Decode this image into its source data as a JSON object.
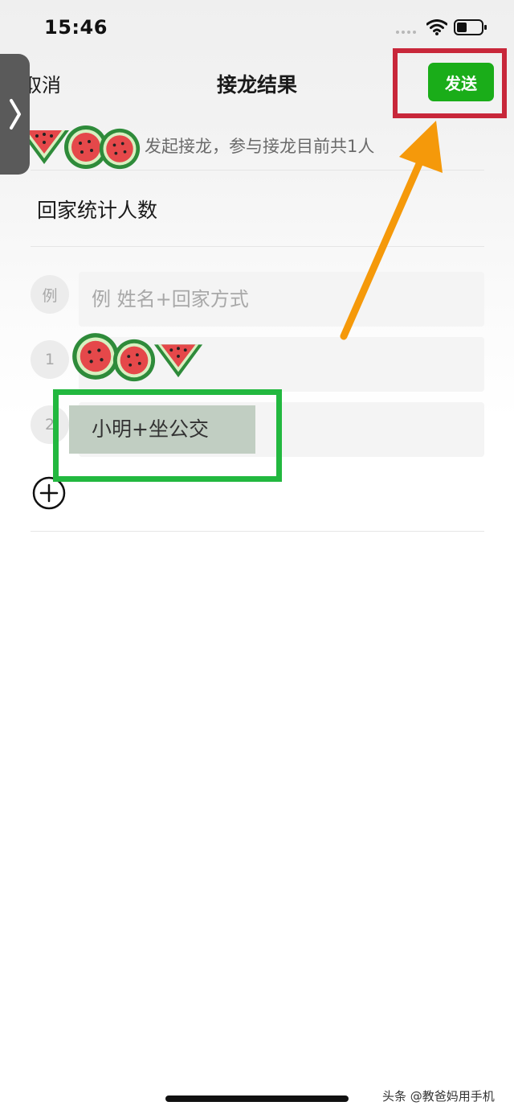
{
  "status_bar": {
    "time": "15:46"
  },
  "nav": {
    "cancel_label": "取消",
    "title": "接龙结果",
    "send_label": "发送"
  },
  "initiator": {
    "text": "发起接龙，参与接龙目前共1人"
  },
  "subject": "回家统计人数",
  "entries": {
    "example": {
      "badge": "例",
      "placeholder": "例 姓名+回家方式"
    },
    "items": [
      {
        "index": "1",
        "value": ""
      },
      {
        "index": "2",
        "value": "小明+坐公交"
      }
    ]
  },
  "watermark": "头条 @教爸妈用手机",
  "icons": {
    "wifi": "wifi-icon",
    "battery": "battery-icon",
    "add": "plus-circle-icon",
    "handle": "chevron-right-icon",
    "sticker": "watermelon-icon"
  },
  "colors": {
    "send_button": "#1aad19",
    "red_box": "#c8273a",
    "green_box": "#22b83f",
    "arrow": "#f5990a"
  }
}
